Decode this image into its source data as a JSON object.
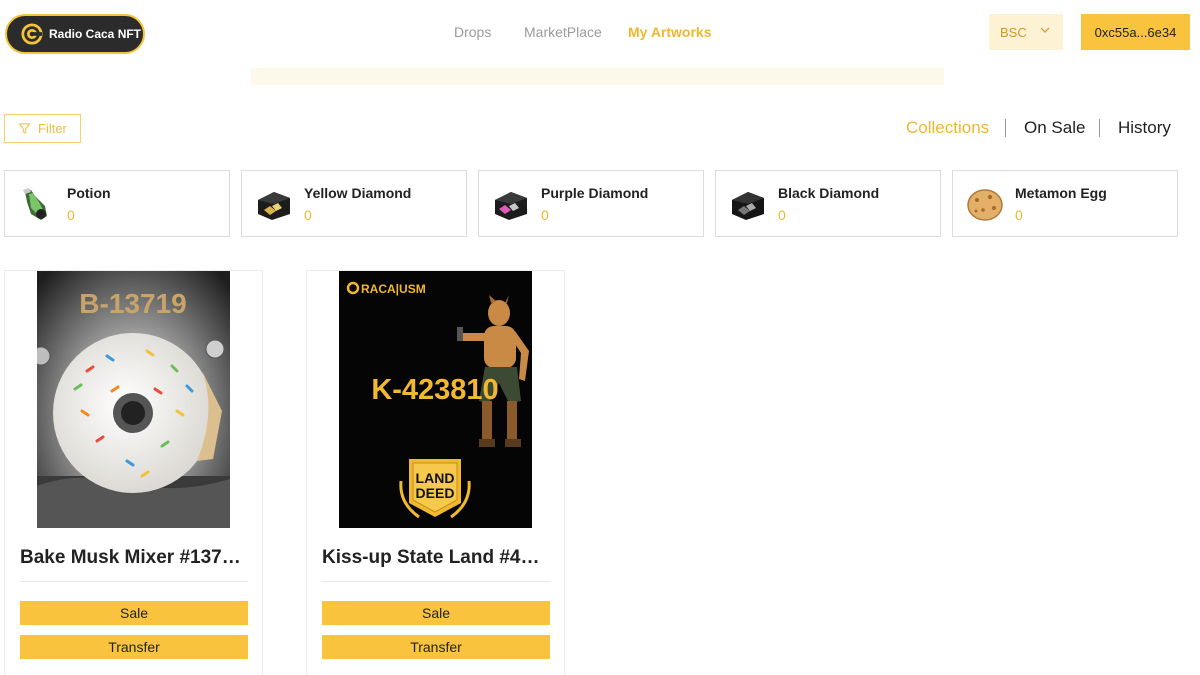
{
  "header": {
    "logo_text": "Radio Caca NFT",
    "nav": [
      "Drops",
      "MarketPlace",
      "My Artworks"
    ],
    "active_nav": "My Artworks",
    "chain": "BSC",
    "wallet": "0xc55a...6e34"
  },
  "filter": {
    "label": "Filter"
  },
  "tabs": [
    "Collections",
    "On Sale",
    "History"
  ],
  "active_tab": "Collections",
  "collections": [
    {
      "name": "Potion",
      "count": "0",
      "icon": "potion-icon"
    },
    {
      "name": "Yellow Diamond",
      "count": "0",
      "icon": "yellow-diamond-box-icon"
    },
    {
      "name": "Purple Diamond",
      "count": "0",
      "icon": "purple-diamond-box-icon"
    },
    {
      "name": "Black Diamond",
      "count": "0",
      "icon": "black-diamond-box-icon"
    },
    {
      "name": "Metamon Egg",
      "count": "0",
      "icon": "metamon-egg-icon"
    }
  ],
  "artworks": [
    {
      "title": "Bake Musk Mixer #1371...",
      "art_label": "B-13719",
      "sale_label": "Sale",
      "transfer_label": "Transfer"
    },
    {
      "title": "Kiss-up State Land #423...",
      "art_label": "K-423810",
      "art_brand": "RACA|USM",
      "art_badge_line1": "LAND",
      "art_badge_line2": "DEED",
      "sale_label": "Sale",
      "transfer_label": "Transfer"
    }
  ],
  "colors": {
    "accent": "#f9c33e",
    "accent_text": "#f0b72e",
    "logo_bg": "#2b2b2b"
  }
}
